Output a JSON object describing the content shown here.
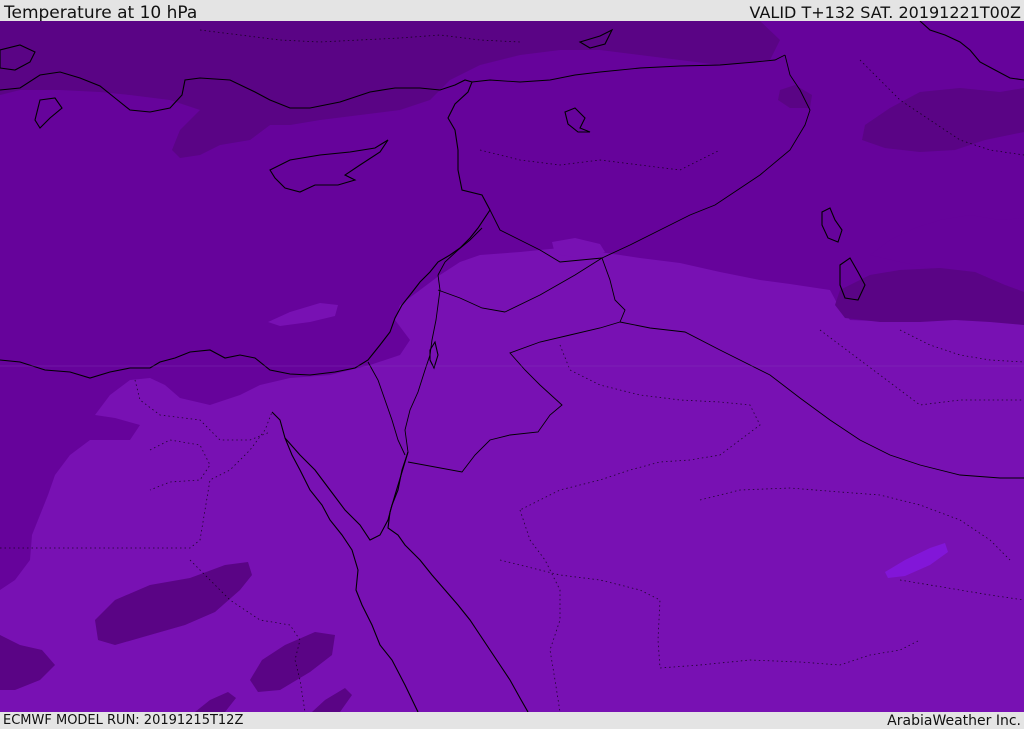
{
  "header": {
    "title": "Temperature at 10 hPa",
    "valid_label": "VALID T+132 SAT. 20191221T00Z"
  },
  "footer": {
    "model_run": "ECMWF MODEL RUN: 20191215T12Z",
    "credit": "ArabiaWeather Inc."
  },
  "colors": {
    "band_coldest": "#5a0485",
    "band_cold": "#66039b",
    "band_mid": "#7811b3",
    "band_warm": "#8216d8",
    "border": "#000000"
  }
}
